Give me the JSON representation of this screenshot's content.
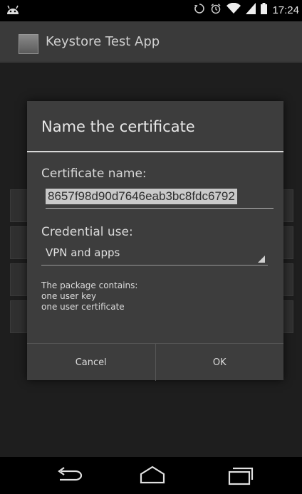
{
  "status_bar": {
    "time": "17:24",
    "left_icon": "android-debug-icon",
    "icons": [
      "sync-icon",
      "alarm-icon",
      "wifi-icon",
      "signal-icon",
      "battery-icon"
    ]
  },
  "app": {
    "title": "Keystore Test App"
  },
  "dialog": {
    "title": "Name the certificate",
    "cert_name_label": "Certificate name:",
    "cert_name_value": "8657f98d90d7646eab3bc8fdc6792",
    "credential_use_label": "Credential use:",
    "credential_use_value": "VPN and apps",
    "package_info": [
      "The package contains:",
      "one user key",
      "one user certificate"
    ],
    "cancel_label": "Cancel",
    "ok_label": "OK"
  },
  "nav": {
    "icons": [
      "back-icon",
      "home-icon",
      "recents-icon"
    ]
  }
}
